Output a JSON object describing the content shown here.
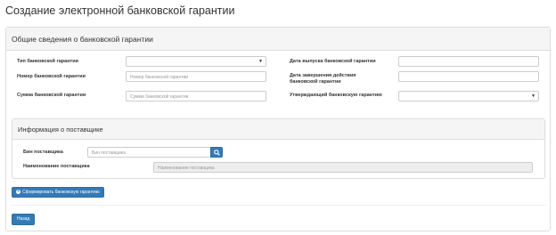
{
  "page": {
    "title": "Создание электронной банковской гарантии"
  },
  "general": {
    "heading": "Общие сведения о банковской гарантии",
    "type_label": "Тип банковской гарантии",
    "number_label": "Номер банковской гарантии",
    "number_placeholder": "Номер банковской гарантии",
    "sum_label": "Сумма банковской гарантии",
    "sum_placeholder": "Сумма банковской гарантии",
    "issue_date_label": "Дата выпуска банковской гарантии",
    "end_date_label_line1": "Дата завершения действия",
    "end_date_label_line2": "банковской гарантии",
    "approver_label": "Утверждающий банковскую гарантию"
  },
  "supplier": {
    "heading": "Информация о поставщике",
    "bin_label": "Бин поставщика",
    "bin_placeholder": "Бин поставщика",
    "name_label": "Наименование поставщика",
    "name_placeholder": "Наименование поставщика"
  },
  "actions": {
    "generate_label": "Сформировать банковскую гарантию",
    "back_label": "Назад"
  },
  "icons": {
    "select": "chevron-down-icon",
    "search": "search-icon",
    "generate": "plus-circle-icon"
  },
  "colors": {
    "primary": "#337ab7",
    "panel_heading": "#f5f5f5",
    "border": "#dddddd"
  }
}
